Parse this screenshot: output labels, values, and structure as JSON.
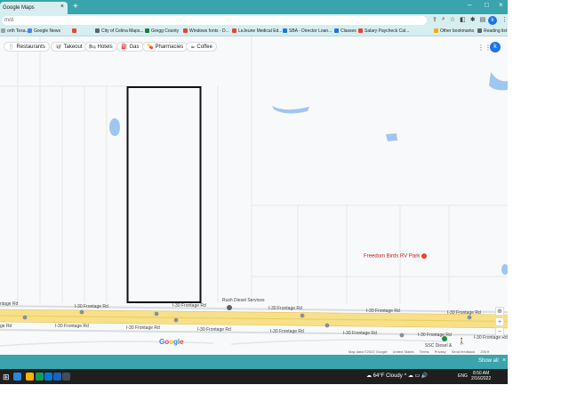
{
  "browser": {
    "tab_title": "Google Maps",
    "tab_close": "×",
    "new_tab": "+",
    "url": "m/d",
    "window_controls": {
      "minimize": "–",
      "maximize": "□",
      "close": "×"
    },
    "profile_initial": "k",
    "toolbar_icons": [
      "share-icon",
      "zoom-icon",
      "star-icon",
      "extension-icon",
      "puzzle-icon",
      "sidebar-icon"
    ]
  },
  "bookmarks": {
    "items": [
      {
        "label": "orth Texa...",
        "color": "#9aa0a6"
      },
      {
        "label": "Google News",
        "color": "#4285f4"
      },
      {
        "label": "",
        "color": "#ea4335"
      },
      {
        "label": "City of Celina Maps...",
        "color": "#5f6368"
      },
      {
        "label": "Gregg County",
        "color": "#188038"
      },
      {
        "label": "Windows fonts - D...",
        "color": "#ea4335"
      },
      {
        "label": "LeJeune Medical Ed...",
        "color": "#ea4335"
      },
      {
        "label": "SBA - Director Loan...",
        "color": "#1a73e8"
      },
      {
        "label": "Classes",
        "color": "#1a73e8"
      },
      {
        "label": "Salary Paycheck Cal...",
        "color": "#ea4335"
      }
    ],
    "other": "Other bookmarks",
    "reading": "Reading list"
  },
  "chips": [
    {
      "label": "Restaurants",
      "icon": "🍴"
    },
    {
      "label": "Takeout",
      "icon": "🥡"
    },
    {
      "label": "Hotels",
      "icon": "🛏"
    },
    {
      "label": "Gas",
      "icon": "⛽"
    },
    {
      "label": "Pharmacies",
      "icon": "💊"
    },
    {
      "label": "Coffee",
      "icon": "☕"
    }
  ],
  "map": {
    "account_initial": "k",
    "apps_icon": "⋮⋮⋮",
    "labels": {
      "frontage_1": "I-30 Frontage Rd",
      "frontage_2": "I-30 Frontage Rd",
      "frontage_3": "I-30 Frontage Rd",
      "frontage_4": "I-30 Frontage Rd",
      "frontage_5": "I-30 Frontage Rd",
      "frontage_6": "I-30 Frontage Rd",
      "frontage_7": "I-30 Frontage Rd",
      "frontage_8": "I-30 Frontage Rd",
      "frontage_9": "I-30 Frontage Rd",
      "frontage_10": "I-30 Frontage Rd",
      "frontage_11": "I-30 Frontage Rd",
      "rush_diesel": "Rush Diesel Services",
      "ssc": "SSC Diesel &",
      "ge": "ge Rd",
      "frontage_left": "ntage Rd",
      "frontage_right": "I-30 Frontage Rd"
    },
    "poi": "Freedom Birds RV Park",
    "google": [
      "G",
      "o",
      "o",
      "g",
      "l",
      "e"
    ],
    "google_colors": [
      "#4285f4",
      "#ea4335",
      "#fbbc05",
      "#4285f4",
      "#34a853",
      "#ea4335"
    ],
    "footer": [
      "Map data ©2022 Google",
      "United States",
      "Terms",
      "Privacy",
      "Send feedback",
      "200 ft"
    ],
    "zoom_in": "+",
    "zoom_out": "−",
    "location": "⊕",
    "pegman": "🚶"
  },
  "download_bar": {
    "show_all": "Show all",
    "close": "×"
  },
  "taskbar": {
    "start": "⊞",
    "weather": "64°F Cloudy",
    "tray": "^ ☁ ▭ 🔊",
    "language": "ENG",
    "time": "8:50 AM",
    "date": "2/16/2022",
    "icons": [
      "#2b88d8",
      "#f4b400",
      "#0f9d58",
      "#0078d4",
      "#1565c0",
      "#444c56"
    ]
  }
}
